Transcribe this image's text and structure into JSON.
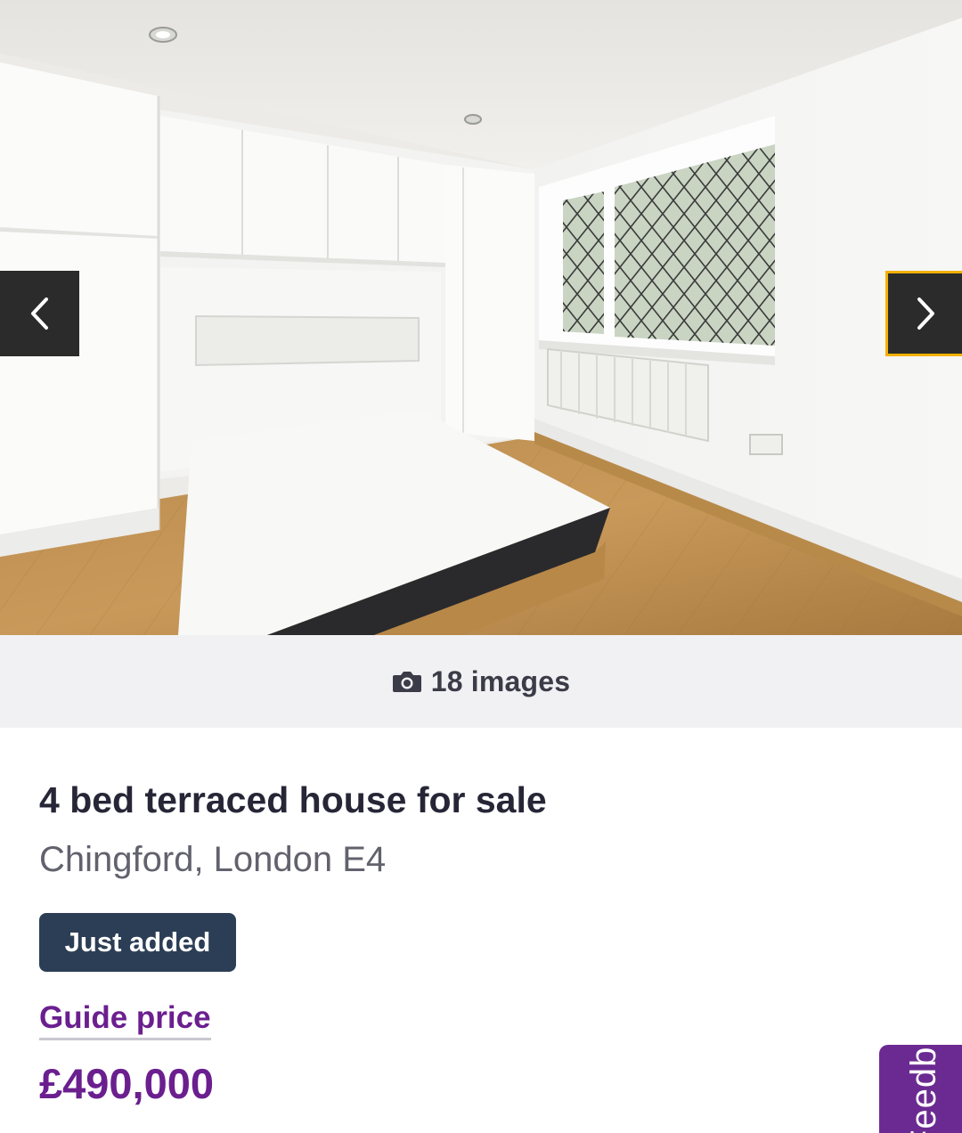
{
  "gallery": {
    "prev_icon": "chevron-left-icon",
    "next_icon": "chevron-right-icon",
    "image_count_icon": "camera-icon",
    "image_count": "18 images"
  },
  "listing": {
    "title": "4 bed terraced house for sale",
    "address": "Chingford, London E4",
    "badge": "Just added",
    "price_qualifier": "Guide price",
    "price": "£490,000"
  },
  "feedback_tab": {
    "label": "Feedback"
  },
  "colors": {
    "accent_purple": "#6b1f8f",
    "badge_bg": "#2c3e55",
    "nav_focus": "#f2b000"
  }
}
